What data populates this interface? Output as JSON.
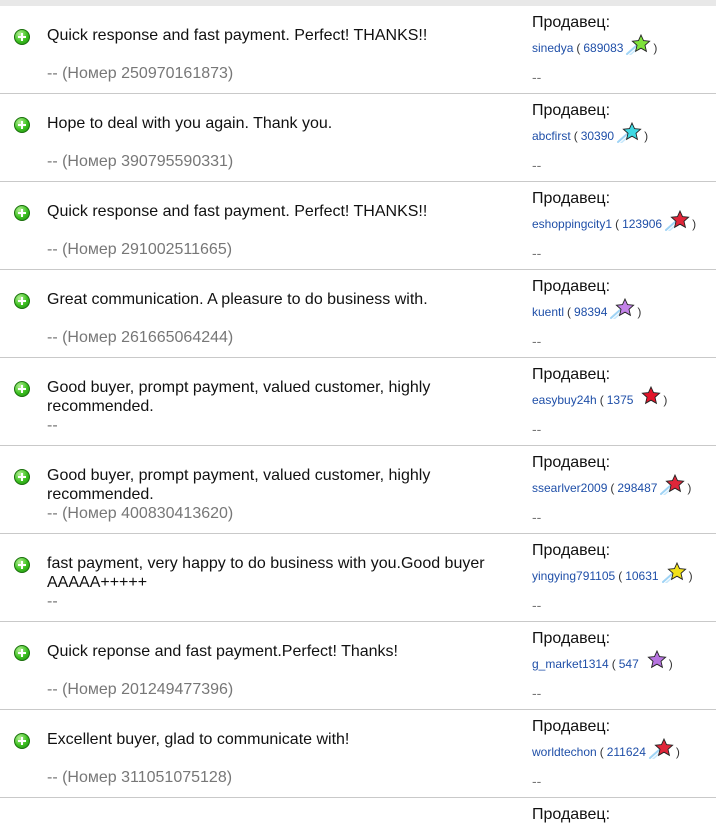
{
  "rows": [
    {
      "comment": "Quick response and fast payment. Perfect! THANKS!!",
      "item": "-- (Номер 250970161873)",
      "role": "Продавец:",
      "seller": "sinedya",
      "rating": "689083",
      "open": "(",
      "close": ")",
      "dash": "--",
      "star_color": "#7ee23a"
    },
    {
      "comment": "Hope to deal with you again. Thank you.",
      "item": "-- (Номер 390795590331)",
      "role": "Продавец:",
      "seller": "abcfirst",
      "rating": "30390",
      "open": "(",
      "close": ")",
      "dash": "--",
      "star_color": "#3fd9e3"
    },
    {
      "comment": "Quick response and fast payment. Perfect! THANKS!!",
      "item": "-- (Номер 291002511665)",
      "role": "Продавец:",
      "seller": "eshoppingcity1",
      "rating": "123906",
      "open": "(",
      "close": ")",
      "dash": "--",
      "star_color": "#e0263a"
    },
    {
      "comment": "Great communication. A pleasure to do business with.",
      "item": "-- (Номер 261665064244)",
      "role": "Продавец:",
      "seller": "kuentl",
      "rating": "98394",
      "open": "(",
      "close": ")",
      "dash": "--",
      "star_color": "#c383e8"
    },
    {
      "comment": "Good buyer, prompt payment, valued customer, highly recommended.",
      "item": "--",
      "role": "Продавец:",
      "seller": "easybuy24h",
      "rating": "1375",
      "open": "(",
      "close": ")",
      "dash": "--",
      "star_color": "#e2162a"
    },
    {
      "comment": "Good buyer, prompt payment, valued customer, highly recommended.",
      "item": "-- (Номер 400830413620)",
      "role": "Продавец:",
      "seller": "ssearlver2009",
      "rating": "298487",
      "open": "(",
      "close": ")",
      "dash": "--",
      "star_color": "#e0263a"
    },
    {
      "comment": "fast payment, very happy to do business with you.Good buyer AAAAA+++++",
      "item": "--",
      "role": "Продавец:",
      "seller": "yingying791105",
      "rating": "10631",
      "open": "(",
      "close": ")",
      "dash": "--",
      "star_color": "#f2e21a"
    },
    {
      "comment": "Quick reponse and fast payment.Perfect! Thanks!",
      "item": "-- (Номер 201249477396)",
      "role": "Продавец:",
      "seller": "g_market1314",
      "rating": "547",
      "open": "(",
      "close": ")",
      "dash": "--",
      "star_color": "#b774e0"
    },
    {
      "comment": "Excellent buyer, glad to communicate with!",
      "item": "-- (Номер 311051075128)",
      "role": "Продавец:",
      "seller": "worldtechon",
      "rating": "211624",
      "open": "(",
      "close": ")",
      "dash": "--",
      "star_color": "#e0263a"
    },
    {
      "comment": "",
      "item": "",
      "role": "Продавец:",
      "seller": "",
      "rating": "",
      "open": "",
      "close": "",
      "dash": "",
      "star_color": ""
    }
  ]
}
